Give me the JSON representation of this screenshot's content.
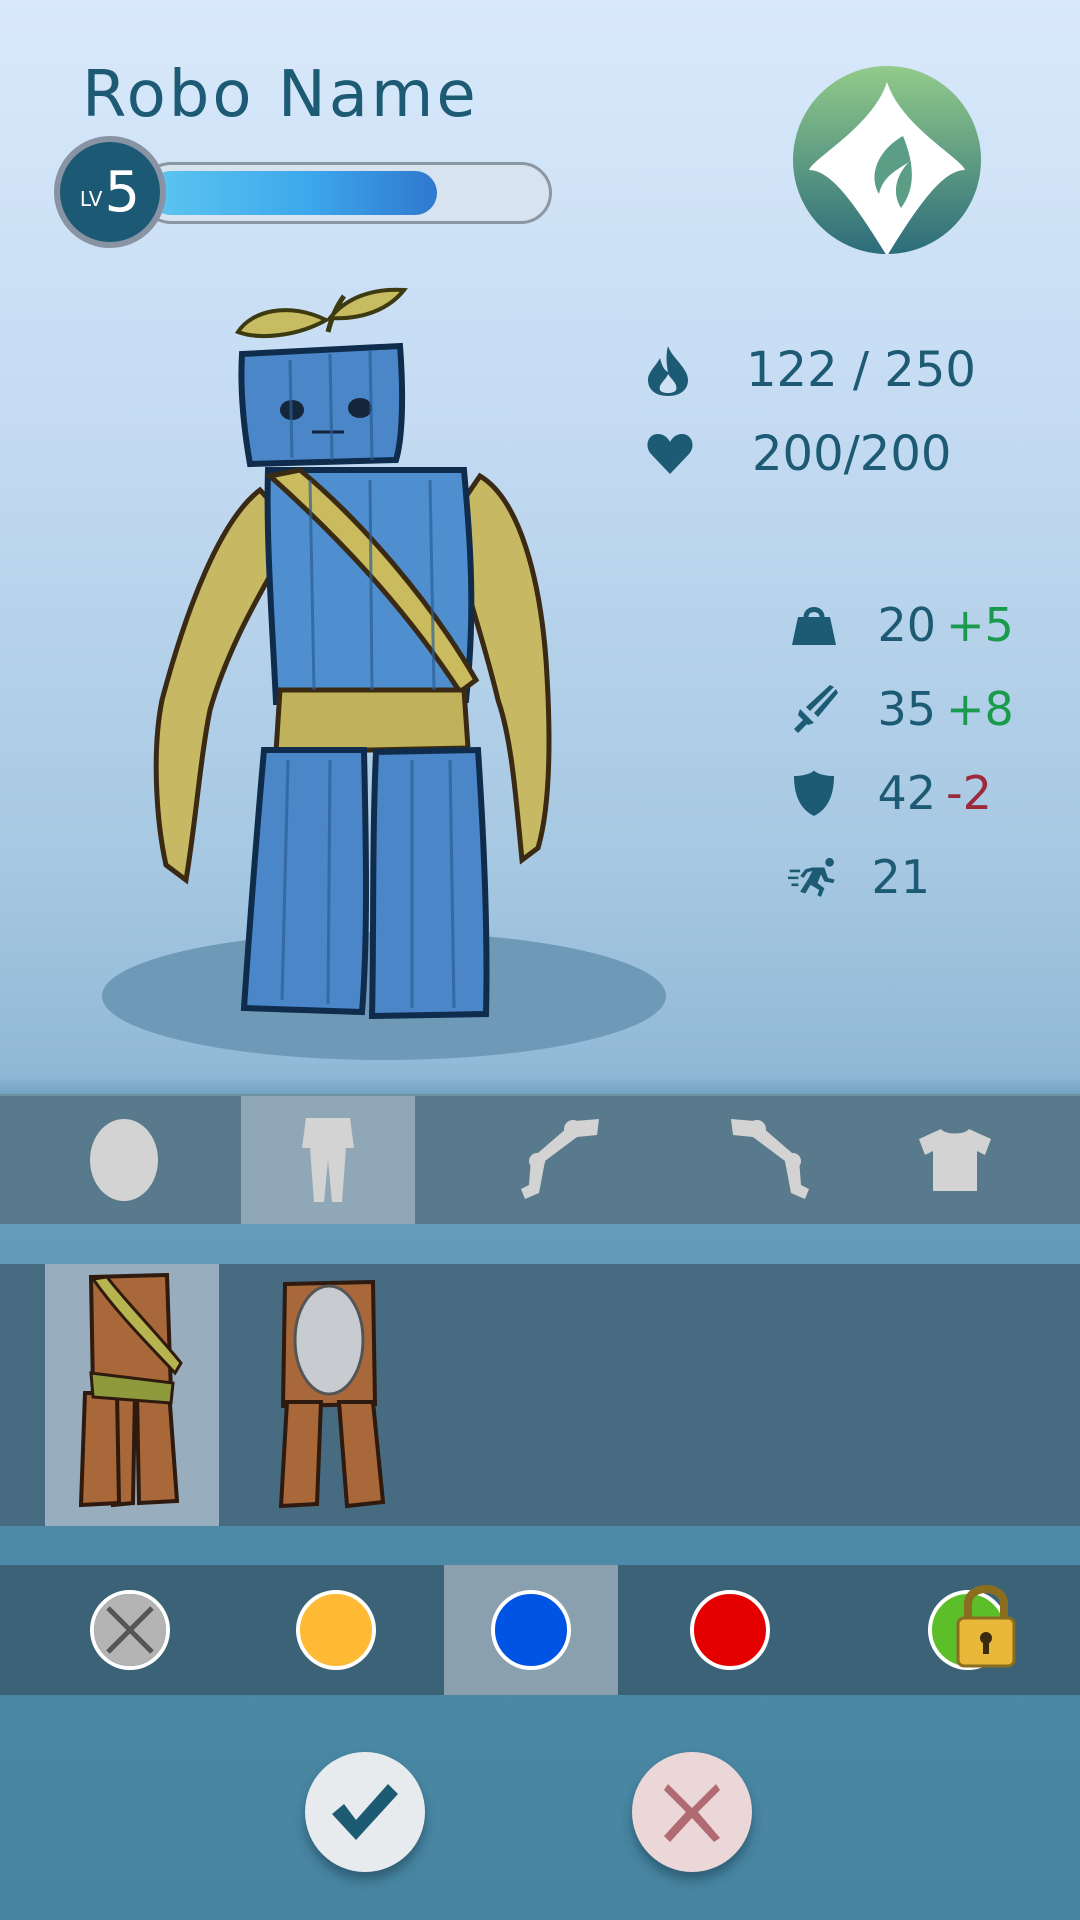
{
  "hero": {
    "name": "Robo Name",
    "level_prefix": "LV",
    "level": "5",
    "xp_fraction": 0.73
  },
  "vitals": [
    {
      "icon": "flame-icon",
      "value": "122 / 250"
    },
    {
      "icon": "heart-icon",
      "value": "200/200"
    }
  ],
  "attributes": [
    {
      "icon": "weight-icon",
      "value": "20",
      "modifier": "+5",
      "trend": "up"
    },
    {
      "icon": "sword-icon",
      "value": "35",
      "modifier": "+8",
      "trend": "up"
    },
    {
      "icon": "shield-icon",
      "value": "42",
      "modifier": "-2",
      "trend": "down"
    },
    {
      "icon": "running-icon",
      "value": "21",
      "modifier": "",
      "trend": "none"
    }
  ],
  "slots": [
    {
      "icon": "head-slot-icon",
      "active": false
    },
    {
      "icon": "legs-slot-icon",
      "active": true
    },
    {
      "icon": "left-arm-slot-icon",
      "active": false
    },
    {
      "icon": "right-arm-slot-icon",
      "active": false
    },
    {
      "icon": "shirt-slot-icon",
      "active": false
    }
  ],
  "items": [
    {
      "icon": "wooden-legs-sash-icon",
      "active": true
    },
    {
      "icon": "wooden-legs-shield-icon",
      "active": false
    }
  ],
  "colors": [
    {
      "name": "none-color-icon",
      "hex": "#b4b4b4",
      "active": false
    },
    {
      "name": "yellow",
      "hex": "#ffba35",
      "active": false
    },
    {
      "name": "blue",
      "hex": "#0054e3",
      "active": true
    },
    {
      "name": "red",
      "hex": "#e50000",
      "active": false
    },
    {
      "name": "locked-green",
      "hex": "#5cbf2a",
      "active": false,
      "locked": true
    }
  ],
  "actions": {
    "confirm_icon": "checkmark-icon",
    "cancel_icon": "cancel-x-icon"
  },
  "palette": {
    "accent": "#1d5a73",
    "positive": "#1a9a4c",
    "negative": "#9b2a3a"
  }
}
